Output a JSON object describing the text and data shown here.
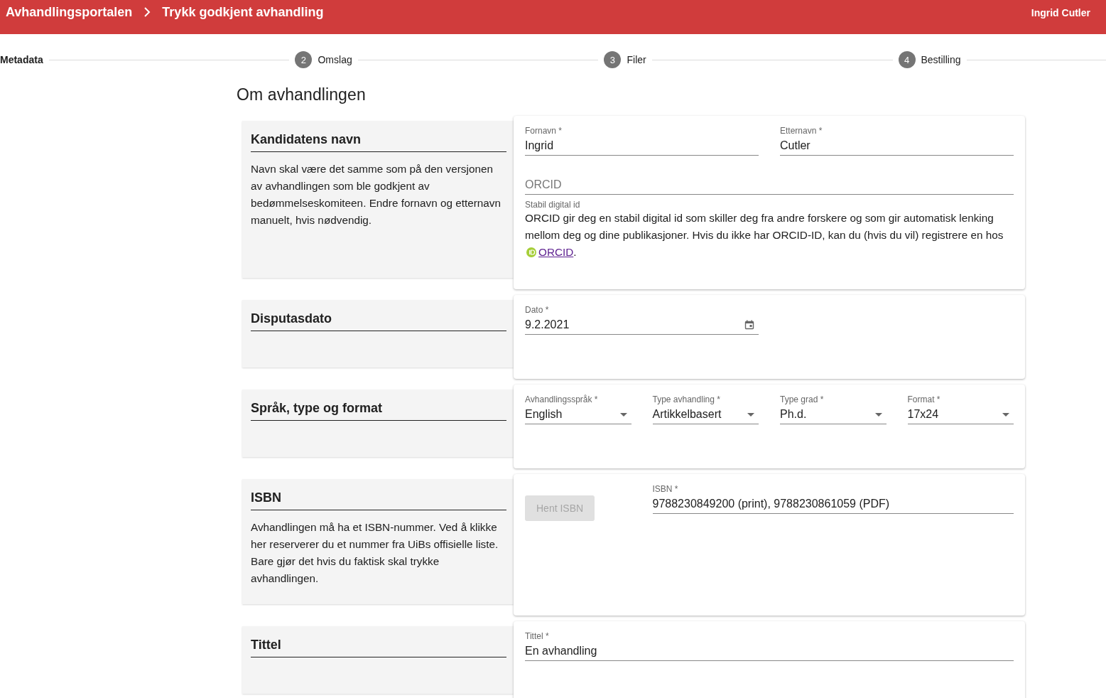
{
  "header": {
    "breadcrumbs": [
      "Avhandlingsportalen",
      "Trykk godkjent avhandling"
    ],
    "user": "Ingrid Cutler"
  },
  "steps": [
    {
      "label": "Metadata",
      "selected": true
    },
    {
      "number": "2",
      "label": "Omslag",
      "selected": false
    },
    {
      "number": "3",
      "label": "Filer",
      "selected": false
    },
    {
      "number": "4",
      "label": "Bestilling",
      "selected": false
    }
  ],
  "page_title": "Om avhandlingen",
  "sections": [
    {
      "heading": "Kandidatens navn",
      "description": "Navn skal være det samme som på den versjonen av avhandlingen som ble godkjent av bedømmelseskomiteen. Endre fornavn og etternavn manuelt, hvis nødvendig.",
      "fields": [
        {
          "kind": "text",
          "label": "Fornavn *",
          "value": "Ingrid"
        },
        {
          "kind": "text",
          "label": "Etternavn *",
          "value": "Cutler"
        },
        {
          "kind": "orcid",
          "placeholder": "ORCID",
          "hint": "Stabil digital id",
          "help_text": "ORCID gir deg en stabil digital id som skiller deg fra andre forskere og som gir automatisk lenking mellom deg og dine publikasjoner. Hvis du ikke har ORCID-ID, kan du (hvis du vil) registrere en hos ",
          "link": "ORCID",
          "after_link": "."
        }
      ]
    },
    {
      "heading": "Disputasdato",
      "fields": [
        {
          "kind": "date",
          "label": "Dato *",
          "value": "9.2.2021"
        }
      ]
    },
    {
      "heading": "Språk, type og format",
      "fields": [
        {
          "kind": "select",
          "label": "Avhandlingsspråk *",
          "value": "English"
        },
        {
          "kind": "select",
          "label": "Type avhandling *",
          "value": "Artikkelbasert"
        },
        {
          "kind": "select",
          "label": "Type grad *",
          "value": "Ph.d."
        },
        {
          "kind": "select",
          "label": "Format *",
          "value": "17x24"
        }
      ]
    },
    {
      "heading": "ISBN",
      "description": "Avhandlingen må ha et ISBN-nummer. Ved å klikke her reserverer du et nummer fra UiBs offisielle liste. Bare gjør det hvis du faktisk skal trykke avhandlingen.",
      "fields": [
        {
          "kind": "button",
          "label": "Hent ISBN",
          "disabled": true
        },
        {
          "kind": "text",
          "label": "ISBN *",
          "value": "9788230849200 (print), 9788230861059 (PDF)"
        }
      ]
    },
    {
      "heading": "Tittel",
      "fields": [
        {
          "kind": "text",
          "label": "Tittel *",
          "value": "En avhandling"
        }
      ]
    }
  ]
}
